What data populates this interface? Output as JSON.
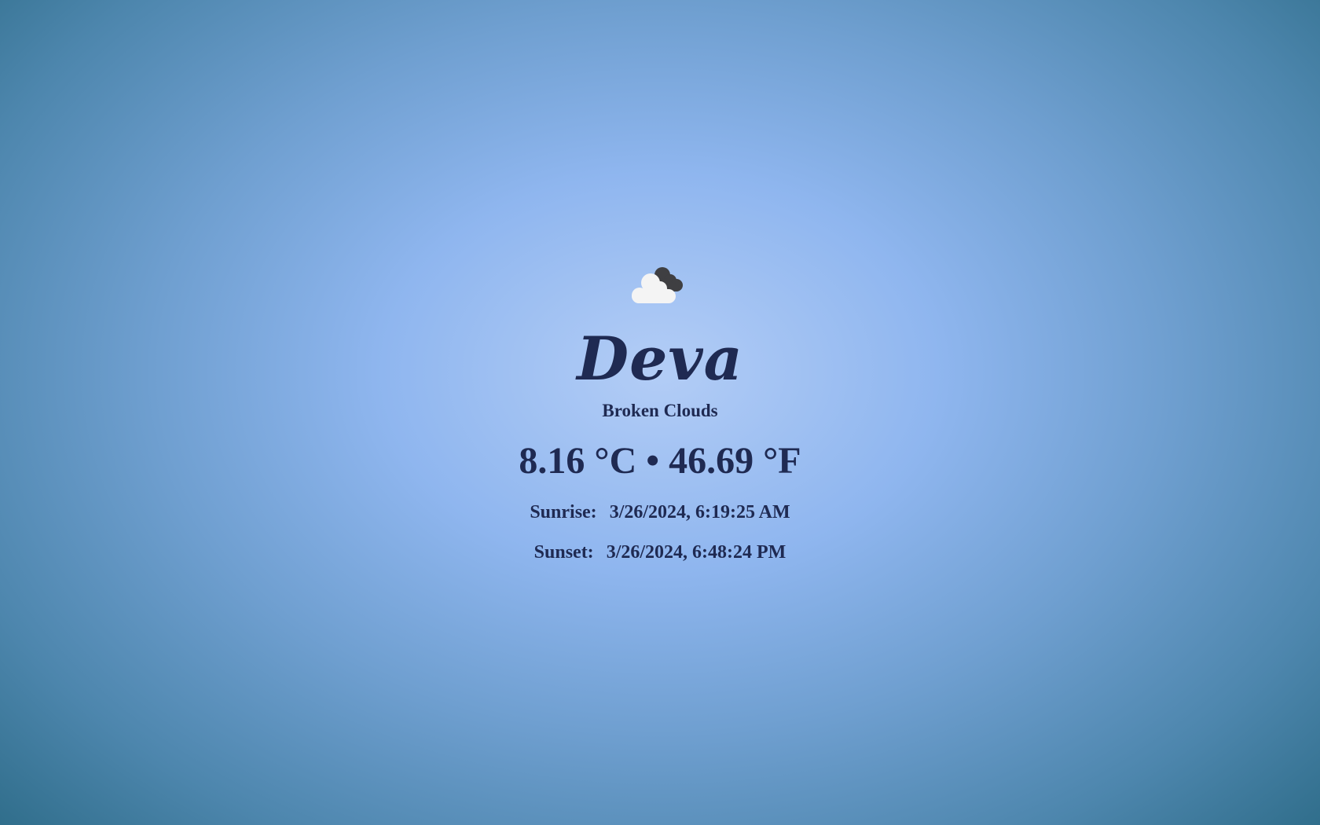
{
  "weather": {
    "icon": "broken-clouds-icon",
    "city": "Deva",
    "description": "Broken Clouds",
    "temp_c": "8.16 °C",
    "separator": "•",
    "temp_f": "46.69 °F",
    "sunrise_label": "Sunrise:",
    "sunrise_value": "3/26/2024, 6:19:25 AM",
    "sunset_label": "Sunset:",
    "sunset_value": "3/26/2024, 6:48:24 PM"
  },
  "colors": {
    "text": "#1f2a52",
    "background_center": "#b3cdf6",
    "background_edge": "#2f6d8a",
    "cloud_front": "#f4f4f4",
    "cloud_back": "#3f3f42"
  }
}
